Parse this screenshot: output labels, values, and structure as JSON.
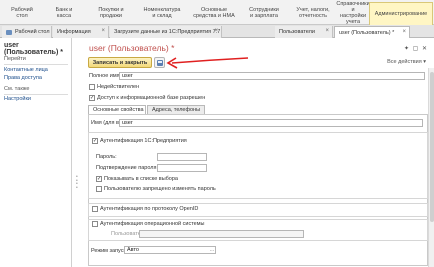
{
  "sections": [
    {
      "label": "Рабочий\nстол"
    },
    {
      "label": "Банк и\nкасса"
    },
    {
      "label": "Покупки и\nпродажи"
    },
    {
      "label": "Номенклатура\nи склад"
    },
    {
      "label": "Основные\nсредства и НМА"
    },
    {
      "label": "Сотрудники\nи зарплата"
    },
    {
      "label": "Учет, налоги,\nотчетность"
    },
    {
      "label": "Справочники и\nнастройки учета"
    },
    {
      "label": "Администрирование"
    }
  ],
  "tabs": [
    {
      "label": "Рабочий стол"
    },
    {
      "label": "Информация"
    },
    {
      "label": "Загрузите данные из 1С:Предприятия 7.7"
    },
    {
      "label": "Пользователи"
    },
    {
      "label": "user (Пользователь) *"
    }
  ],
  "tab_close": "×",
  "left_panel": {
    "title": "user (Пользователь) *",
    "goto_header": "Перейти",
    "goto_links": [
      "Контактные лица",
      "Права доступа"
    ],
    "see_also_header": "См. также",
    "see_also_links": [
      "Настройки"
    ]
  },
  "form": {
    "title": "user (Пользователь) *",
    "tools": "✦ ▢ ✕",
    "save_close": "Записать и закрыть",
    "more": "Все действия ▾",
    "full_name_label": "Полное имя:",
    "full_name_value": "user",
    "invalid_label": "Недействителен",
    "invalid_checked": "",
    "access_label": "Доступ к информационной базе разрешен",
    "access_checked": "✓",
    "subtab_main": "Основные свойства",
    "subtab_contacts": "Адреса, телефоны",
    "login_label": "Имя (для входа):",
    "login_value": "user",
    "auth_1c_label": "Аутентификация 1С:Предприятия",
    "auth_1c_checked": "✓",
    "password_label": "Пароль:",
    "password_confirm_label": "Подтверждение пароля:",
    "show_in_list_label": "Показывать в списке выбора",
    "show_in_list_checked": "✓",
    "no_change_password_label": "Пользователю запрещено изменять пароль",
    "no_change_password_checked": "",
    "openid_label": "Аутентификация по протоколу OpenID",
    "openid_checked": "",
    "os_auth_label": "Аутентификация операционной системы",
    "os_auth_checked": "",
    "os_user_label": "Пользователь:",
    "run_mode_label": "Режим запуска:",
    "run_mode_value": "Авто",
    "select_button": "..."
  },
  "colors": {
    "accent_title": "#c0504d",
    "annotation_arrow": "#e02020",
    "active_section": "#fff6c4"
  }
}
